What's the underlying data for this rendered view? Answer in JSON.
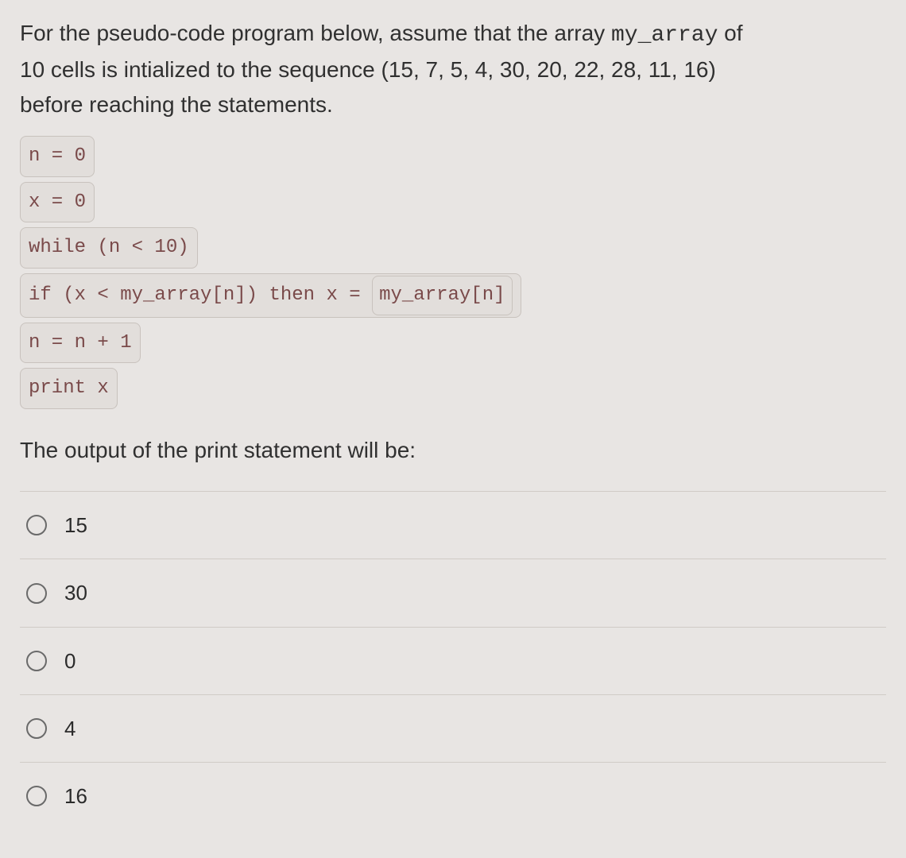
{
  "question": {
    "line1_a": "For the pseudo-code program below, assume that the array ",
    "line1_code": "my_array",
    "line1_b": " of",
    "line2": "10 cells is intialized to the sequence (15, 7, 5, 4, 30, 20, 22, 28, 11, 16)",
    "line3": "before reaching the statements."
  },
  "code": {
    "l1": "n = 0",
    "l2": "x = 0",
    "l3": "while (n < 10)",
    "l4_a": "if (x < my_array[n]) then x = ",
    "l4_b": "my_array[n]",
    "l5": "n = n + 1",
    "l6": "print x"
  },
  "followup": "The output of the print statement will be:",
  "options": [
    "15",
    "30",
    "0",
    "4",
    "16"
  ]
}
